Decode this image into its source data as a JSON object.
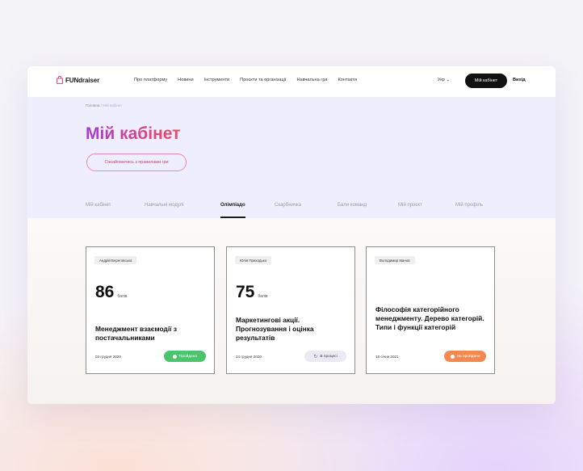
{
  "app": {
    "logo_text": "FUNdraiser"
  },
  "nav": {
    "items": [
      "Про платформу",
      "Новини",
      "Інструменти",
      "Проєкти та організації",
      "Навчальна гра",
      "Контакти"
    ],
    "lang": "Укр ⌄",
    "cabinet_button": "Мій кабінет",
    "exit": "Вихід"
  },
  "hero": {
    "breadcrumb_home": "Головна",
    "breadcrumb_sep": " / ",
    "breadcrumb_current": "Мій кабінет",
    "title": "Мій кабінет",
    "rules_button": "Ознайомитись з правилами гри"
  },
  "tabs": {
    "items": [
      "Мій кабінет",
      "Навчальні модулі",
      "Олімпіадо",
      "Скарбничка",
      "Бали команд",
      "Мій проєкт",
      "Мій профіль"
    ],
    "active_index": 2
  },
  "cards": [
    {
      "author": "Андрій Береговська",
      "score": "86",
      "score_unit": "балів",
      "title": "Менеджмент взаємодії з постачальниками",
      "date": "03 грудня 2020",
      "status": "Пройдено",
      "status_color": "#4cc36d"
    },
    {
      "author": "Юлія Приходько",
      "score": "75",
      "score_unit": "балів",
      "title": "Маркетингові акції. Прогнозування і оцінка результатів",
      "date": "24 грудня 2020",
      "status": "В процесі",
      "status_color": "#ebeaf4"
    },
    {
      "author": "Володимир Іванов",
      "title": "Філософія категорійного менеджменту. Дерево категорій. Типи і функції категорій",
      "date": "18 січня 2021",
      "status": "Не пройдено",
      "status_color": "#f08a52"
    }
  ],
  "colors": {
    "hero_bg": "#eeeefc",
    "accent_pink": "#e0457b",
    "accent_purple": "#a23fd6"
  }
}
